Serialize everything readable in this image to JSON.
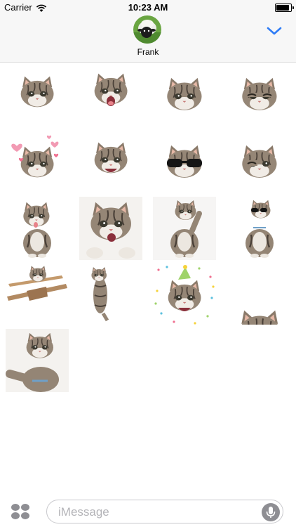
{
  "status_bar": {
    "carrier": "Carrier",
    "time": "10:23 AM",
    "battery_level": 1.0
  },
  "header": {
    "contact_name": "Frank",
    "avatar_icon": "sheep-avatar",
    "collapse_icon": "chevron-down-icon",
    "accent_color": "#2f7cf6"
  },
  "stickers": [
    {
      "kind": "kitten-face"
    },
    {
      "kind": "kitten-face-meowing"
    },
    {
      "kind": "kitten-face-looking"
    },
    {
      "kind": "kitten-face-squinting"
    },
    {
      "kind": "kitten-face-hearts"
    },
    {
      "kind": "kitten-face-laughing"
    },
    {
      "kind": "kitten-face-sunglasses"
    },
    {
      "kind": "kitten-face-winking"
    },
    {
      "kind": "kitten-licking"
    },
    {
      "kind": "kitten-meowing-paws"
    },
    {
      "kind": "kitten-waving"
    },
    {
      "kind": "kitten-sitting-sunglasses"
    },
    {
      "kind": "kitten-on-biplane"
    },
    {
      "kind": "kitten-climbing"
    },
    {
      "kind": "kitten-party-hat-confetti"
    },
    {
      "kind": "kitten-peeking"
    },
    {
      "kind": "kitten-reaching"
    }
  ],
  "input_bar": {
    "placeholder": "iMessage",
    "apps_icon": "apps-grid-icon",
    "mic_icon": "microphone-icon"
  }
}
